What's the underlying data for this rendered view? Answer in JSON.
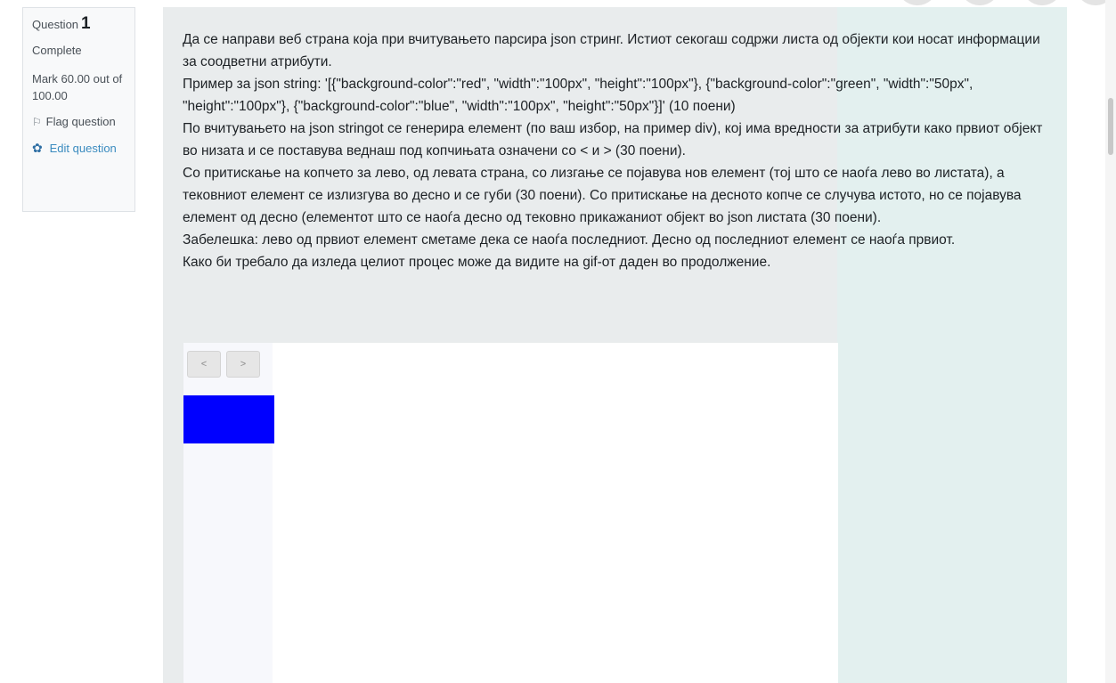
{
  "info": {
    "question_label": "Question",
    "question_number": "1",
    "state": "Complete",
    "grade": "Mark 60.00 out of 100.00",
    "flag_icon": "flag-icon",
    "flag_label": "Flag question",
    "edit_icon": "gear-icon",
    "edit_label": "Edit question"
  },
  "question": {
    "paragraphs": [
      "Да се направи веб страна која при вчитувањето парсира json стринг. Истиот секогаш содржи листа од објекти кои носат информации за соодветни атрибути.",
      "Пример за json string: '[{\"background-color\":\"red\", \"width\":\"100px\", \"height\":\"100px\"}, {\"background-color\":\"green\", \"width\":\"50px\", \"height\":\"100px\"}, {\"background-color\":\"blue\", \"width\":\"100px\", \"height\":\"50px\"}]' (10 поени)",
      "По вчитувањето на json stringot се генерира елемент (по ваш избор, на пример div), кој има вредности за атрибути како првиот објект во низата и се поставува веднаш под копчињата означени со < и > (30 поени).",
      "Со притискање на копчето за лево, од левата страна, со лизгање се појавува нов елемент (тој што се наоѓа лево во листата), а тековниот елемент се излизгува во десно и се губи (30 поени). Со притискање на десното копче се случува истото, но се појавува елемент од десно (елементот што се наоѓа десно од тековно прикажаниот објект во json листата (30 поени).",
      "Забелешка: лево од првиот елемент сметаме дека се наоѓа последниот. Десно од последниот елемент се наоѓа првиот.",
      "Како би требало да изледа целиот процес може да видите на gif-от даден во продолжение."
    ]
  },
  "demo": {
    "prev_label": "<",
    "next_label": ">",
    "element_color": "#0000ff"
  },
  "colors": {
    "link": "#3a8bbf",
    "panel_bg": "#e9eced"
  }
}
